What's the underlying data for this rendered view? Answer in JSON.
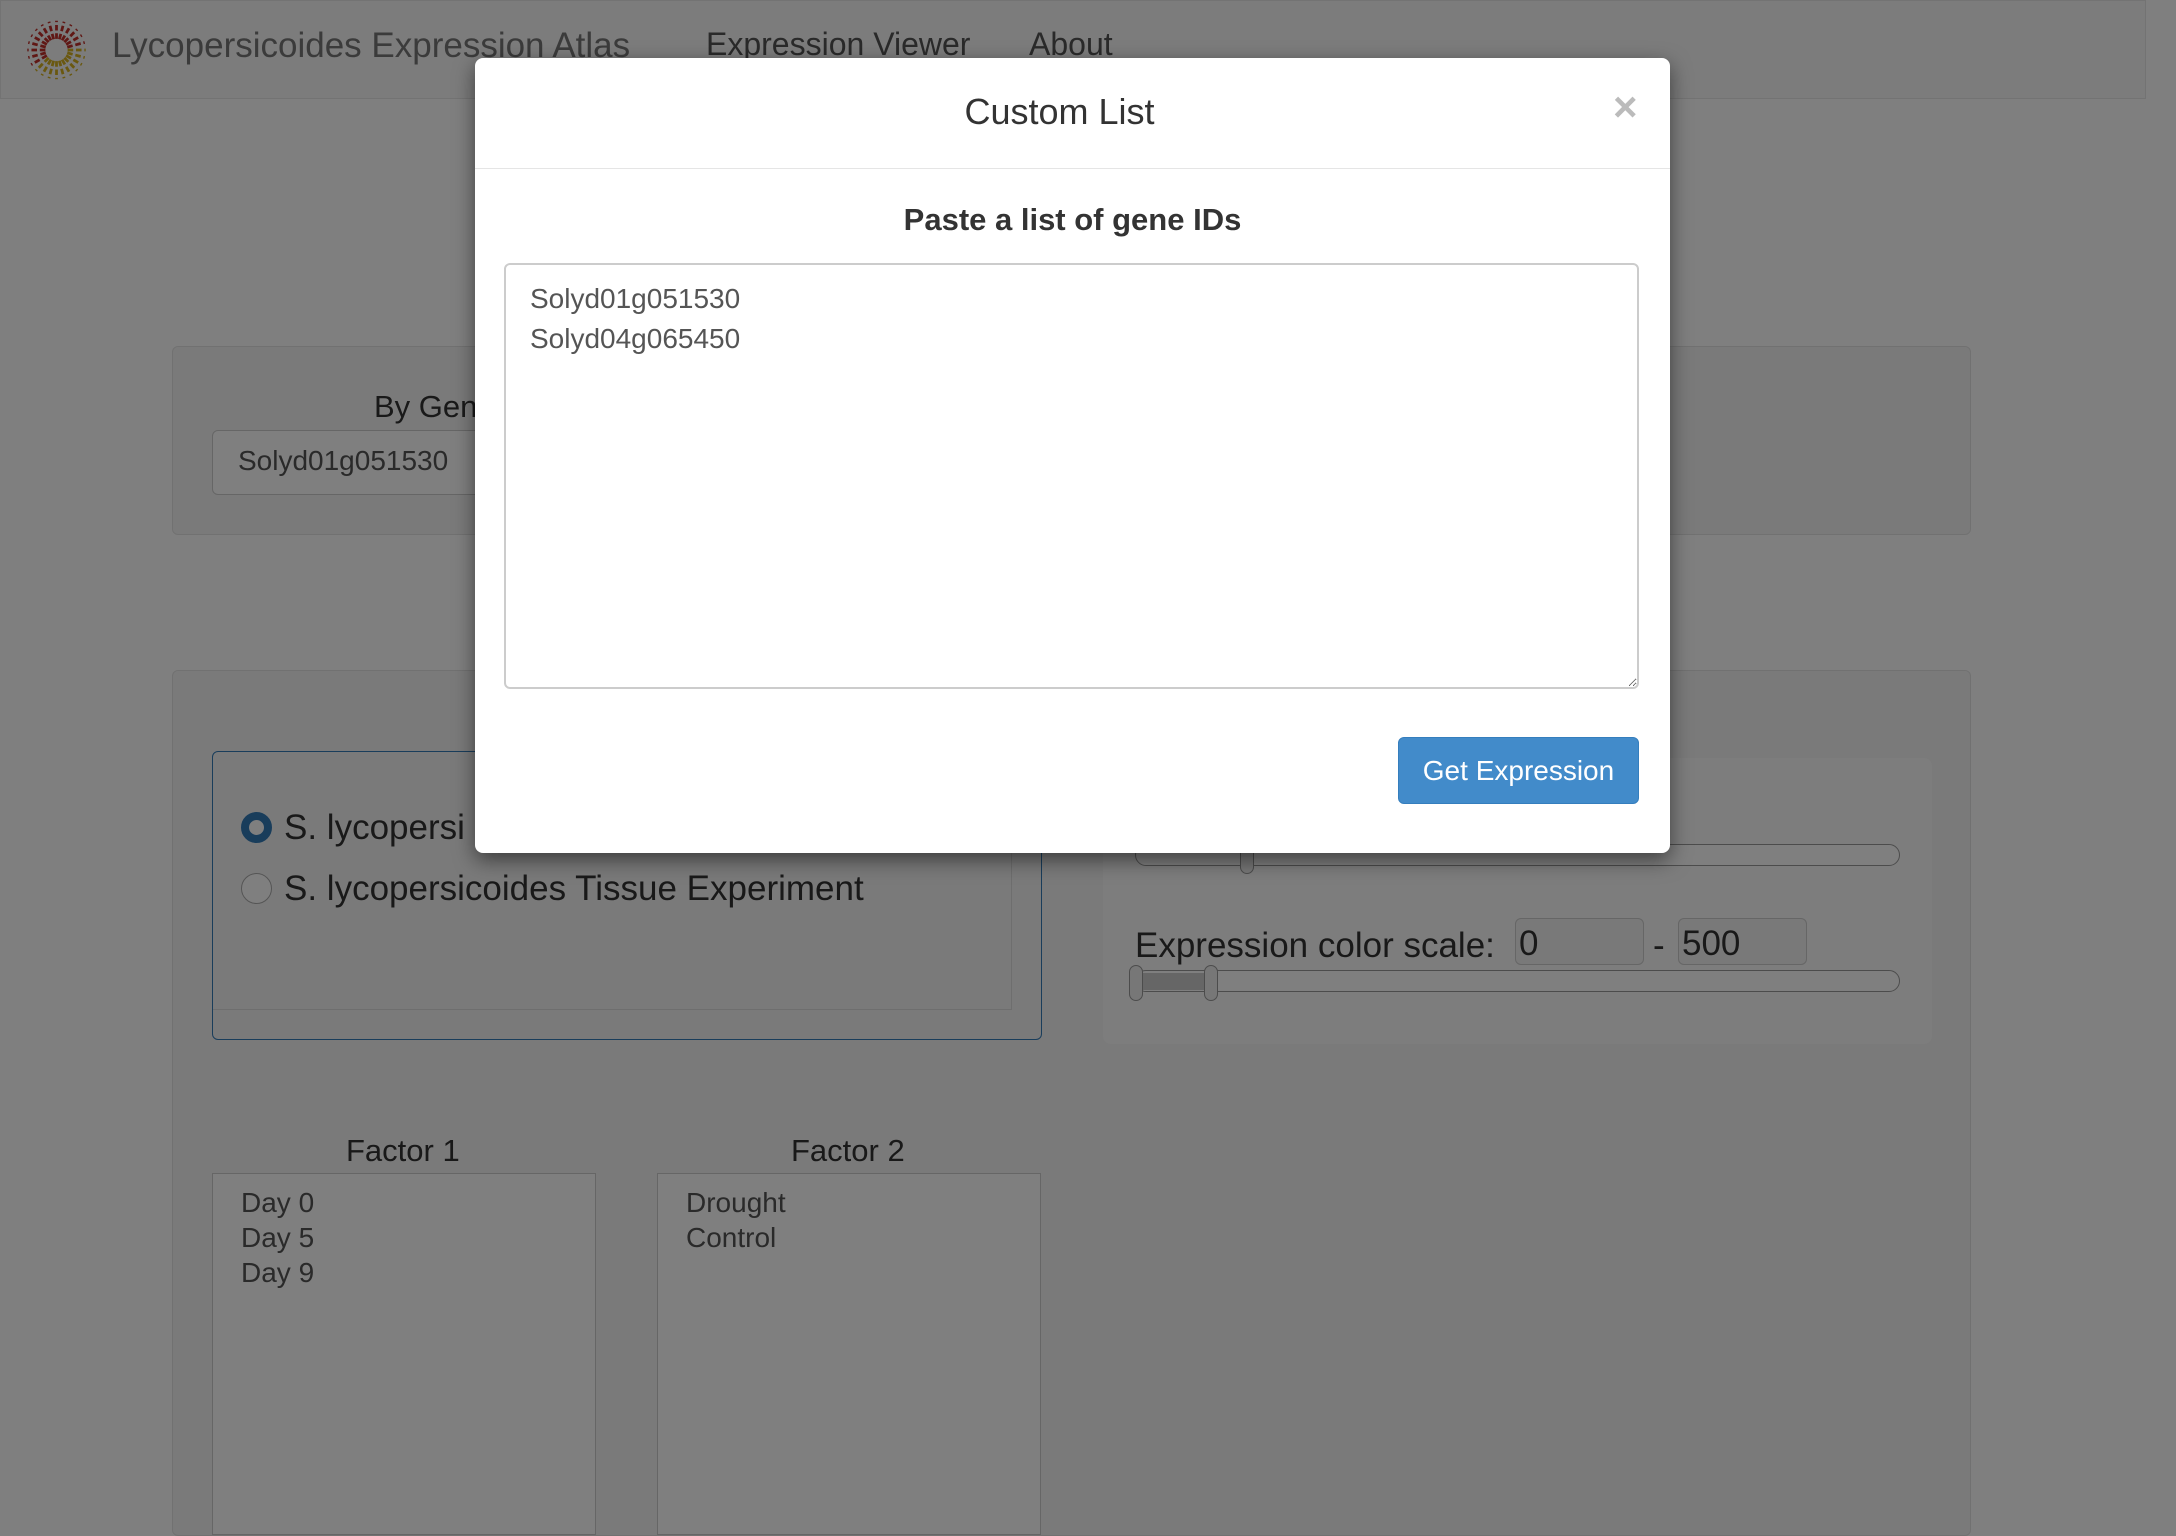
{
  "navbar": {
    "brand": "Lycopersicoides Expression Atlas",
    "links": [
      "Expression Viewer",
      "About"
    ]
  },
  "gene_search": {
    "label": "By Gene",
    "value": "Solyd01g051530"
  },
  "experiments": {
    "options": [
      {
        "label": "S. lycopersi",
        "selected": true
      },
      {
        "label": "S. lycopersicoides Tissue Experiment",
        "selected": false
      }
    ]
  },
  "color_scale": {
    "label": "Expression color scale:",
    "min": "0",
    "separator": "-",
    "max": "500"
  },
  "factor1": {
    "label": "Factor 1",
    "items": [
      "Day 0",
      "Day 5",
      "Day 9"
    ]
  },
  "factor2": {
    "label": "Factor 2",
    "items": [
      "Drought",
      "Control"
    ]
  },
  "modal": {
    "title": "Custom List",
    "close": "×",
    "subtitle": "Paste a list of gene IDs",
    "textarea_value": "Solyd01g051530\nSolyd04g065450",
    "button": "Get Expression"
  },
  "colors": {
    "primary": "#428bca"
  }
}
